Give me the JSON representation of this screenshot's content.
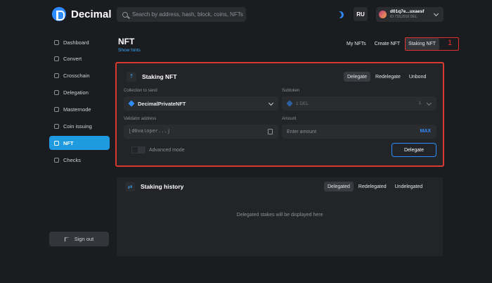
{
  "header": {
    "logo_text": "Decimal",
    "search_placeholder": "Search by address, hash, block, coins, NFTs",
    "lang": "RU",
    "account_address": "d01q7e...uxaesf",
    "account_balance": "ID 718,2916 DEL"
  },
  "sidebar": {
    "items": [
      {
        "label": "Dashboard",
        "icon": "home-icon"
      },
      {
        "label": "Convert",
        "icon": "convert-icon"
      },
      {
        "label": "Crosschain",
        "icon": "crosschain-icon"
      },
      {
        "label": "Delegation",
        "icon": "delegation-icon"
      },
      {
        "label": "Masternode",
        "icon": "masternode-icon"
      },
      {
        "label": "Coin issuing",
        "icon": "coin-icon"
      },
      {
        "label": "NFT",
        "icon": "image-icon"
      },
      {
        "label": "Checks",
        "icon": "checks-icon"
      }
    ],
    "active_index": 6,
    "signout_label": "Sign out"
  },
  "page": {
    "title": "NFT",
    "show_hints": "Show hints",
    "tabs": [
      "My NFTs",
      "Create NFT",
      "Staking NFT"
    ],
    "active_tab": 2,
    "annotation_number": "1"
  },
  "staking": {
    "title": "Staking NFT",
    "modes": [
      "Delegate",
      "Redelegate",
      "Unbond"
    ],
    "active_mode": 0,
    "collection_label": "Collection to send",
    "collection_value": "DecimalPrivateNFT",
    "subtoken_label": "Subtoken",
    "subtoken_value": "1 DEL",
    "subtoken_count": "1",
    "validator_label": "Validator address",
    "validator_placeholder": "[d0valoper...]",
    "amount_label": "Amount",
    "amount_placeholder": "Enter amount",
    "max_label": "MAX",
    "advanced_label": "Advanced mode",
    "submit_label": "Delegate"
  },
  "history": {
    "title": "Staking history",
    "tabs": [
      "Delegated",
      "Redelegated",
      "Undelegated"
    ],
    "active_tab": 0,
    "empty_text": "Delegated stakes will be displayed here"
  },
  "colors": {
    "accent": "#2f8cff",
    "active_nav": "#1e9be0",
    "annotation": "#e0322d",
    "background": "#1b1c1f",
    "card": "#232428"
  }
}
